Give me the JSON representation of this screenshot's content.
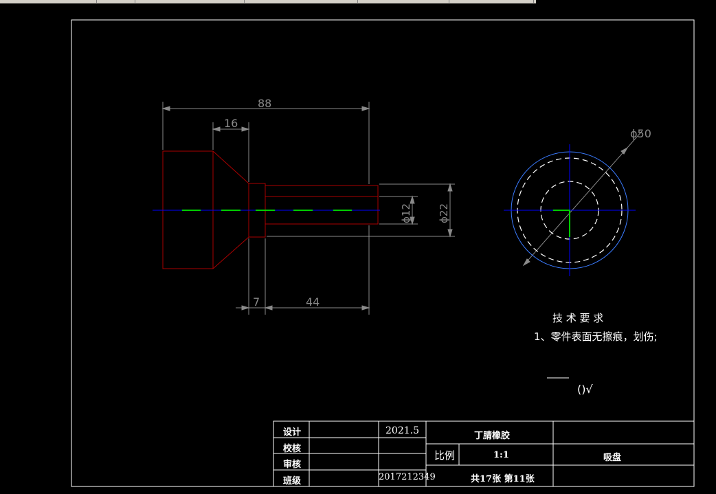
{
  "dimensions": {
    "total_length": "88",
    "head_length": "16",
    "neck_length": "7",
    "stem_length": "44",
    "inner_diameter": "ϕ12",
    "outer_diameter": "ϕ22",
    "disc_diameter": "ϕ50"
  },
  "tech_requirements": {
    "title": "技   术   要   求",
    "item1": "1、零件表面无擦痕，划伤;"
  },
  "surface_finish": "()√",
  "title_block": {
    "design_label": "设计",
    "check_label": "校核",
    "review_label": "审核",
    "class_label": "班级",
    "date": "2021.5",
    "student_id": "2017212349",
    "material": "丁腈橡胶",
    "scale_label": "比例",
    "scale_value": "1:1",
    "part_name": "吸盘",
    "sheet_info": "共17张  第11张"
  },
  "colors": {
    "part_outline": "#aa0000",
    "centerline": "#0000ff",
    "center_mark": "#00cc00",
    "dimension": "#8a8a8a",
    "frame": "#ffffff"
  }
}
